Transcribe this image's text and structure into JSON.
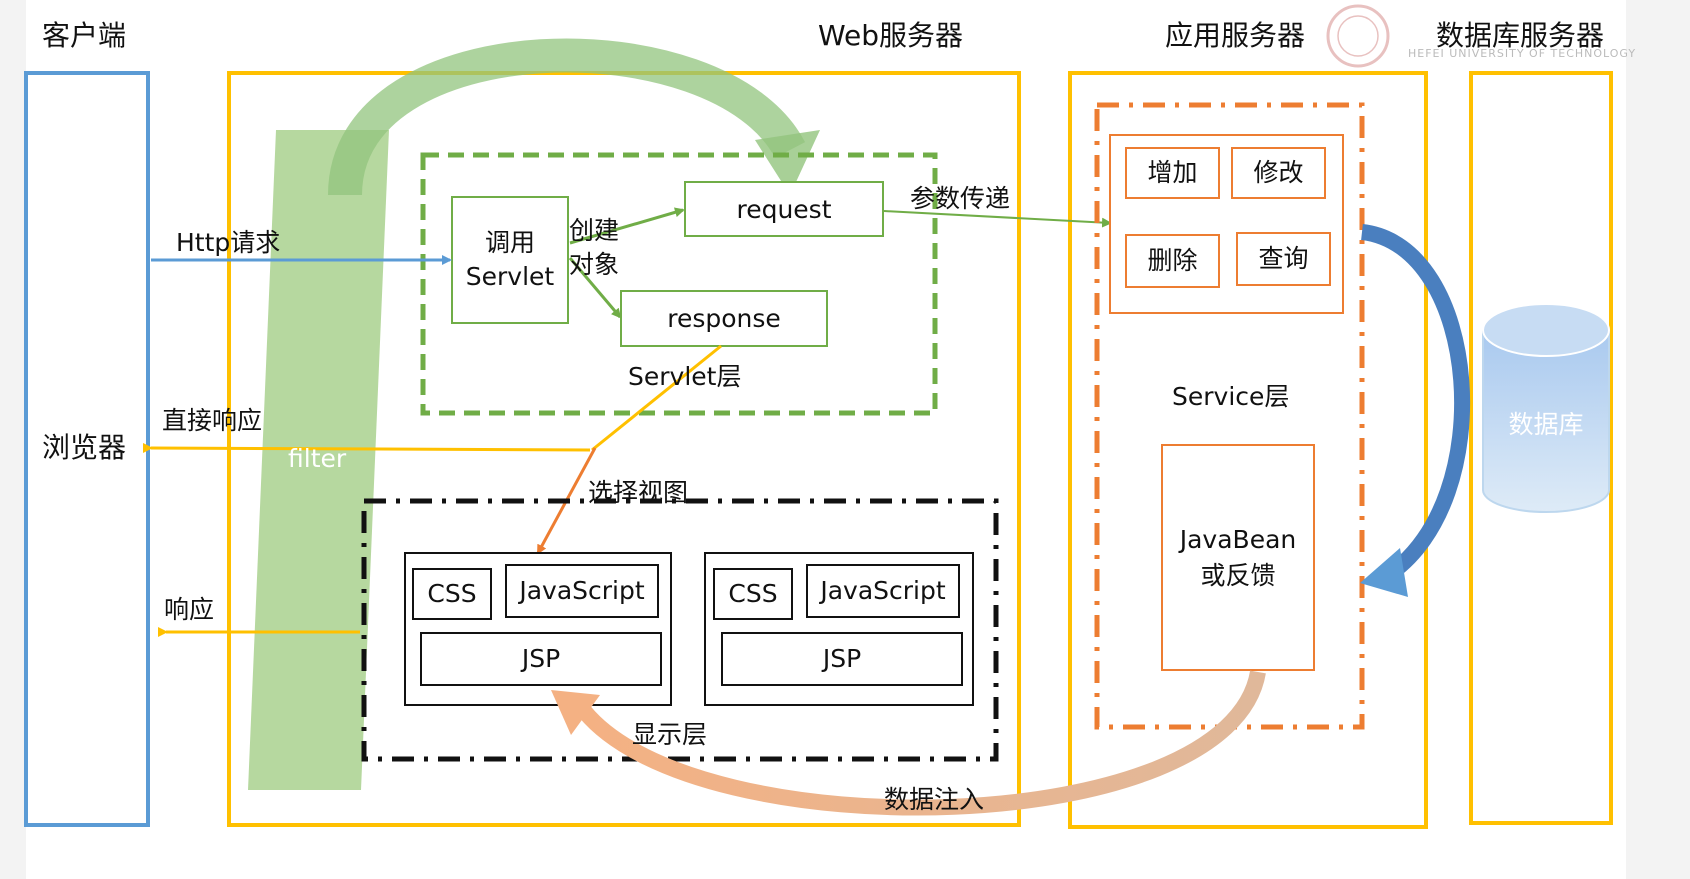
{
  "columns": {
    "client": "客户端",
    "web_server": "Web服务器",
    "app_server": "应用服务器",
    "db_server": "数据库服务器"
  },
  "browser": "浏览器",
  "filter": "filter",
  "servlet_layer": {
    "label": "Servlet层",
    "invoke_servlet": [
      "调用",
      "Servlet"
    ],
    "create_object": [
      "创建",
      "对象"
    ],
    "request": "request",
    "response": "response"
  },
  "arrows": {
    "http_request": "Http请求",
    "direct_response": "直接响应",
    "response": "响应",
    "param_pass": "参数传递",
    "select_view": "选择视图",
    "data_inject": "数据注入"
  },
  "service_layer": {
    "label": "Service层",
    "ops": [
      "增加",
      "修改",
      "删除",
      "查询"
    ],
    "javabean": [
      "JavaBean",
      "或反馈"
    ]
  },
  "view_layer": {
    "label": "显示层",
    "groups": [
      {
        "css": "CSS",
        "js": "JavaScript",
        "jsp": "JSP"
      },
      {
        "css": "CSS",
        "js": "JavaScript",
        "jsp": "JSP"
      }
    ]
  },
  "database": "数据库",
  "watermark": "HEFEI UNIVERSITY OF TECHNOLOGY",
  "colors": {
    "browser_border": "#5b9bd5",
    "server_border": "#ffc000",
    "servlet_green": "#70ad47",
    "service_orange": "#ed7d31",
    "db_fill": "#bdd7ee"
  }
}
